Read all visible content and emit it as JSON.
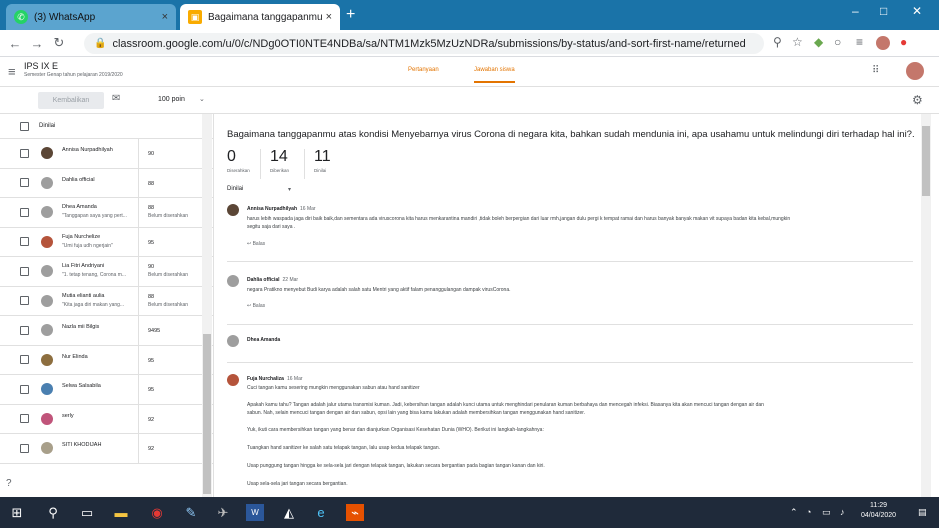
{
  "browser": {
    "tabs": [
      {
        "title": "(3) WhatsApp",
        "close": "×"
      },
      {
        "title": "Bagaimana tanggapanmu atas ko",
        "close": "×"
      }
    ],
    "new_tab": "+",
    "window_controls": {
      "minimize": "–",
      "maximize": "□",
      "close": "✕"
    },
    "url": "classroom.google.com/u/0/c/NDg0OTI0NTE4NDBa/sa/NTM1Mzk5MzUzNDRa/submissions/by-status/and-sort-first-name/returned"
  },
  "classroom": {
    "class_name": "IPS IX E",
    "class_subtitle": "Semester Genap tahun pelajaran 2019/2020",
    "tabs": [
      "Pertanyaan",
      "Jawaban siswa"
    ],
    "toolbar": {
      "return_label": "Kembalikan",
      "points_label": "100 poin"
    }
  },
  "student_list": {
    "header_label": "Dinilai",
    "students": [
      {
        "name": "Annisa Nurpadhilyah",
        "snippet": "",
        "grade": "90",
        "status": ""
      },
      {
        "name": "Dahlia official",
        "snippet": "",
        "grade": "88",
        "status": ""
      },
      {
        "name": "Dhea Amanda",
        "snippet": "\"Tanggapan saya yang pert...",
        "grade": "88",
        "status": "Belum diserahkan"
      },
      {
        "name": "Fuja Nurchelize",
        "snippet": "\"Umi fuja udh ngerjain\"",
        "grade": "95",
        "status": ""
      },
      {
        "name": "Lia Fitri Andriyani",
        "snippet": "\"1. tetap tenang, Corona m...",
        "grade": "90",
        "status": "Belum diserahkan"
      },
      {
        "name": "Mutia elianti aulia",
        "snippet": "\"Kita jaga diri makan yang...",
        "grade": "88",
        "status": "Belum diserahkan"
      },
      {
        "name": "Nazla mii Bilgis",
        "snippet": "",
        "grade": "9495",
        "status": ""
      },
      {
        "name": "Nur Elinda",
        "snippet": "",
        "grade": "95",
        "status": ""
      },
      {
        "name": "Selwa Salsabila",
        "snippet": "",
        "grade": "95",
        "status": ""
      },
      {
        "name": "serly",
        "snippet": "",
        "grade": "92",
        "status": ""
      },
      {
        "name": "SITI KHODIJAH",
        "snippet": "",
        "grade": "92",
        "status": ""
      }
    ]
  },
  "detail": {
    "question": "Bagaimana tanggapanmu atas kondisi Menyebarnya virus Corona di negara kita, bahkan sudah mendunia ini, apa usahamu untuk melindungi diri terhadap hal ini?.",
    "stats": [
      {
        "num": "0",
        "cap": "Diserahkan"
      },
      {
        "num": "14",
        "cap": "Diberikan"
      },
      {
        "num": "11",
        "cap": "Dinilai"
      }
    ],
    "filter_label": "Dinilai",
    "reply_label": "Balas",
    "comments": [
      {
        "name": "Annisa Nurpadhilyah",
        "date": "16 Mar",
        "lines": [
          "harus lebih waspada jaga diri baik baik,dan sementara ada viruscorona kita harus menkarantina mandiri ,tidak boleh berpergian dari luar rmh,jangan dulu pergi k tempat ramai dan harus banyak banyak makan vit supaya badan kita kebal,mungkin",
          "segitu saja dari saya ."
        ]
      },
      {
        "name": "Dahlia official",
        "date": "22 Mar",
        "lines": [
          "negara Pratikno menyebut Budi karya adalah salah satu Mentri yang aktif falam penanggulangan dampak virusCorona."
        ]
      },
      {
        "name": "Dhea Amanda",
        "date": "",
        "lines": []
      },
      {
        "name": "Fuja Nurchaliza",
        "date": "16 Mar",
        "lines": [
          "Cuci tangan kamu sesering mungkin menggunakan sabun atau hand sanitizer",
          "Apakah kamu tahu? Tangan adalah jalur utama transmisi kuman. Jadi, kebersihan tangan adalah kunci utama untuk menghindari penularan kuman berbahaya dan mencegah infeksi. Biasanya kita akan mencuci tangan dengan air dan",
          "sabun. Nah, selain mencuci tangan dengan air dan sabun, opsi lain yang bisa kamu lakukan adalah membersihkan tangan menggunakan hand sanitizer.",
          "Yuk, ikuti cara membersihkan tangan yang benar dan dianjurkan Organisasi Kesehatan Dunia (WHO). Berikut ini langkah-langkahnya:",
          "Tuangkan hand sanitizer ke salah satu telapak tangan, lalu usap kedua telapak tangan.",
          "Usap punggung tangan hingga ke sela-sela jari dengan telapak tangan, lakukan secara bergantian pada bagian tangan kanan dan kiri.",
          "Usap sela-sela jari tangan secara bergantian."
        ]
      }
    ]
  },
  "taskbar": {
    "time": "11:29",
    "date": "04/04/2020"
  }
}
